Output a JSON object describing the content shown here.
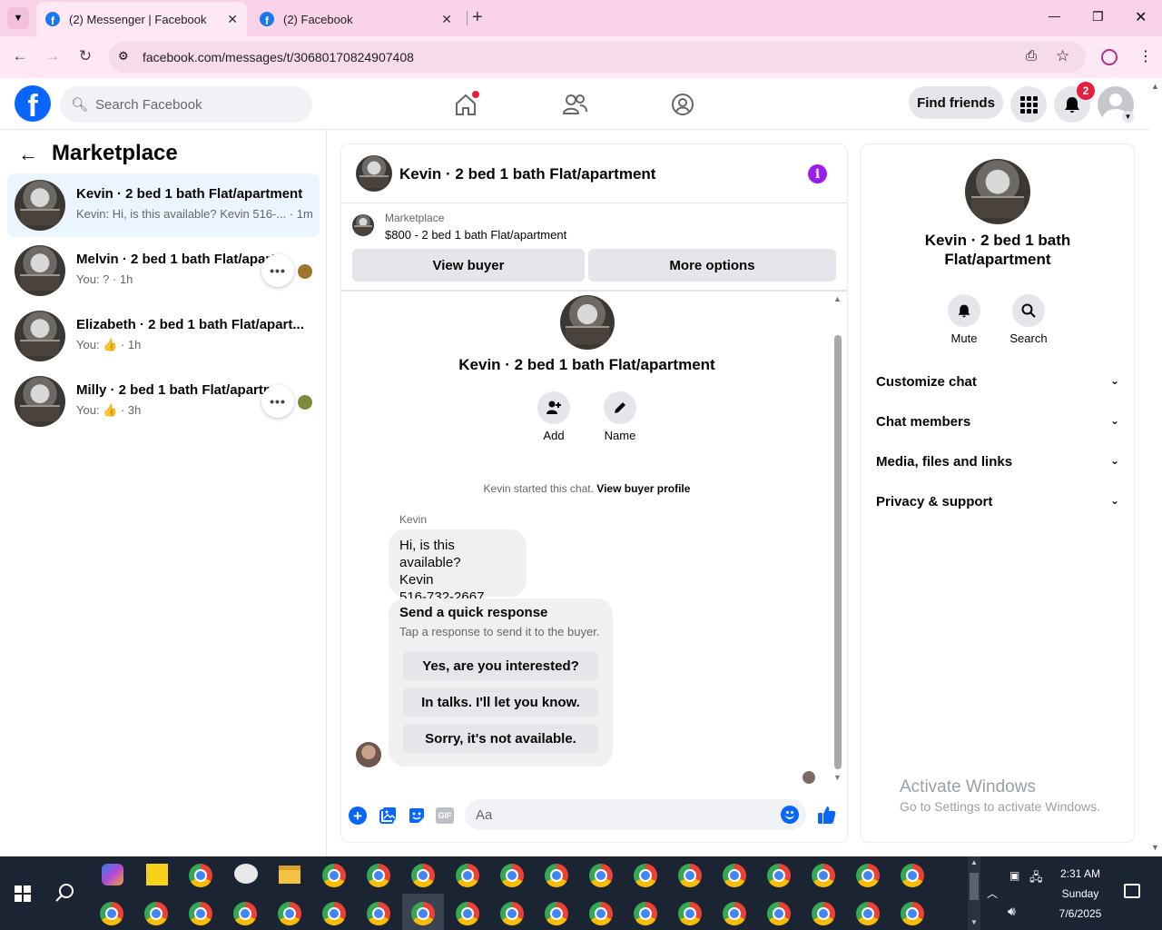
{
  "browser": {
    "tabs": [
      {
        "label": "(2) Messenger | Facebook",
        "close": "✕"
      },
      {
        "label": "(2) Facebook",
        "close": "✕"
      }
    ],
    "new_tab": "+",
    "url": "facebook.com/messages/t/30680170824907408",
    "window_controls": {
      "minimize": "—",
      "restore": "❐",
      "close": "✕"
    }
  },
  "header": {
    "logo": "f",
    "search_placeholder": "Search Facebook",
    "find_friends": "Find friends",
    "notifications_count": "2"
  },
  "sidebar": {
    "title": "Marketplace",
    "conversations": [
      {
        "title": "Kevin · 2 bed 1 bath Flat/apartment",
        "sub": "Kevin: Hi, is this available? Kevin 516-... · 1m"
      },
      {
        "title": "Melvin · 2 bed 1 bath Flat/apart",
        "sub": "You: ? · 1h"
      },
      {
        "title": "Elizabeth · 2 bed 1 bath Flat/apart...",
        "sub": "You: 👍 · 1h"
      },
      {
        "title": "Milly · 2 bed 1 bath Flat/apartm",
        "sub": "You: 👍 · 3h"
      }
    ],
    "dots": "•••"
  },
  "chat": {
    "header_title": "Kevin · 2 bed 1 bath Flat/apartment",
    "listing_source": "Marketplace",
    "listing_title": "$800 - 2 bed 1 bath Flat/apartment",
    "view_buyer": "View buyer",
    "more_options": "More options",
    "profile_name": "Kevin · 2 bed 1 bath Flat/apartment",
    "add_label": "Add",
    "name_label": "Name",
    "started_text": "Kevin started this chat.",
    "view_buyer_profile": "View buyer profile",
    "sender": "Kevin",
    "message_lines": [
      "Hi, is this available?",
      "Kevin",
      "516-732-2667"
    ],
    "quick_title": "Send a quick response",
    "quick_sub": "Tap a response to send it to the buyer.",
    "quick_responses": [
      "Yes, are you interested?",
      "In talks. I'll let you know.",
      "Sorry, it's not available."
    ],
    "input_placeholder": "Aa",
    "gif": "GIF"
  },
  "details": {
    "name_line1": "Kevin · 2 bed 1 bath",
    "name_line2": "Flat/apartment",
    "mute": "Mute",
    "search": "Search",
    "sections": [
      "Customize chat",
      "Chat members",
      "Media, files and links",
      "Privacy & support"
    ]
  },
  "watermark": {
    "line1": "Activate Windows",
    "line2": "Go to Settings to activate Windows."
  },
  "taskbar": {
    "time": "2:31 AM",
    "day": "Sunday",
    "date": "7/6/2025"
  },
  "colors": {
    "fb_blue": "#0866ff",
    "purple_info": "#9b1fe8",
    "tab_bg": "#fbd3e9",
    "taskbar": "#1b2433"
  }
}
